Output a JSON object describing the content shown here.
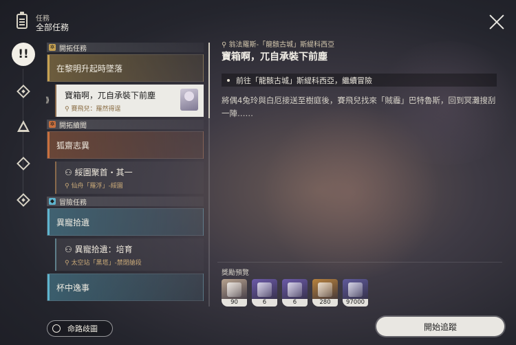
{
  "header": {
    "section_small": "任務",
    "section_title": "全部任務"
  },
  "detail": {
    "location": "翁法羅斯-「龍骸古城」斯緹科西亞",
    "title": "寶箱啊，兀自承裝下前塵",
    "objective": "前往「龍骸古城」斯緹科西亞，繼續冒險",
    "description": "將偶4兔玲與白厄接送至樹庭後，賽飛兒找來「賊霾」巴特魯斯，回到冥灘搜刮一陣……",
    "rewards_title": "獎勵預覽",
    "rewards": [
      {
        "qty": "90",
        "color": "#b7a28e",
        "icon": "crystal-icon"
      },
      {
        "qty": "6",
        "color": "#6b5aa8",
        "icon": "ticket-icon"
      },
      {
        "qty": "6",
        "color": "#6b5aa8",
        "icon": "special-ticket-icon"
      },
      {
        "qty": "280",
        "color": "#b8823d",
        "icon": "potion-icon"
      },
      {
        "qty": "97000",
        "color": "#5f5a9a",
        "icon": "credit-icon"
      }
    ],
    "start_button": "開始追蹤"
  },
  "categories": {
    "trailblaze": "開拓任務",
    "continuance": "開拓續聞",
    "adventure": "冒險任務"
  },
  "quests": {
    "q1": "在黎明升起時墜落",
    "q1_sub_title": "寶箱啊，兀自承裝下前塵",
    "q1_sub_loc": "賽飛兒：羅然得逞",
    "q2": "狐齋志異",
    "q2_sub_title": "綏園聚首・其一",
    "q2_sub_loc": "仙舟「羅浮」-綏園",
    "q3": "異寵拾遺",
    "q3_sub_title": "異寵拾遺：培育",
    "q3_sub_loc": "太空站「黑塔」-禁閉艙段",
    "q4": "杯中逸事"
  },
  "map_button": "命路歧圖",
  "colors": {
    "trailblaze": "#c7a252",
    "continuance": "#c9703e",
    "adventure": "#5fb5cf"
  }
}
